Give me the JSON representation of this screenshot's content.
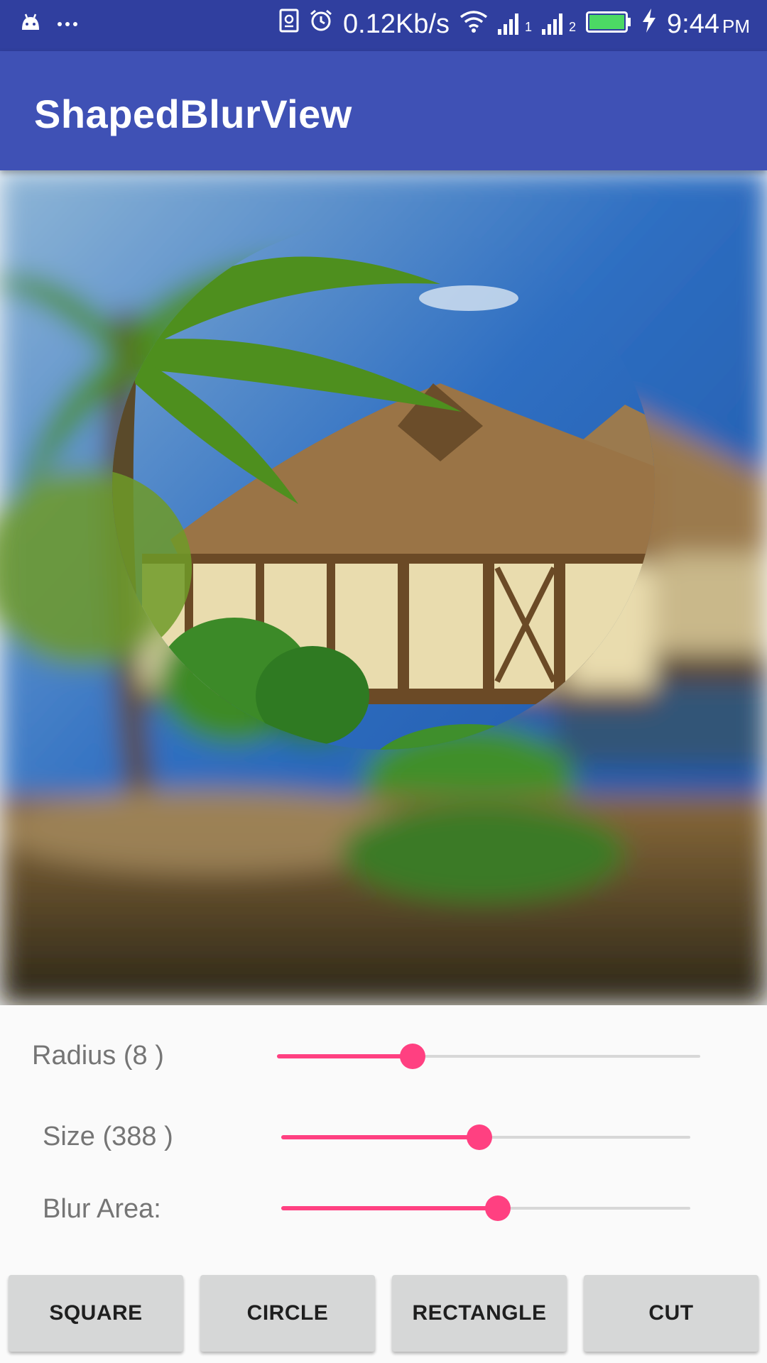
{
  "status_bar": {
    "network_speed": "0.12Kb/s",
    "time": "9:44",
    "ampm": "PM",
    "sim1": "1",
    "sim2": "2",
    "icons": [
      "android-icon",
      "more-icon",
      "nfc-icon",
      "alarm-icon",
      "wifi-icon",
      "signal-icon",
      "battery-icon",
      "charging-icon"
    ],
    "color": "#303f9f"
  },
  "app_bar": {
    "title": "ShapedBlurView",
    "color": "#3f51b5"
  },
  "controls": {
    "radius": {
      "label": "Radius (8 )",
      "value": 0.32
    },
    "size": {
      "label": "Size (388 )",
      "value": 0.485
    },
    "blur_area": {
      "label": "Blur Area:",
      "value": 0.53
    },
    "accent": "#ff4081"
  },
  "buttons": {
    "square": "SQUARE",
    "circle": "CIRCLE",
    "rectangle": "RECTANGLE",
    "cut": "CUT"
  }
}
